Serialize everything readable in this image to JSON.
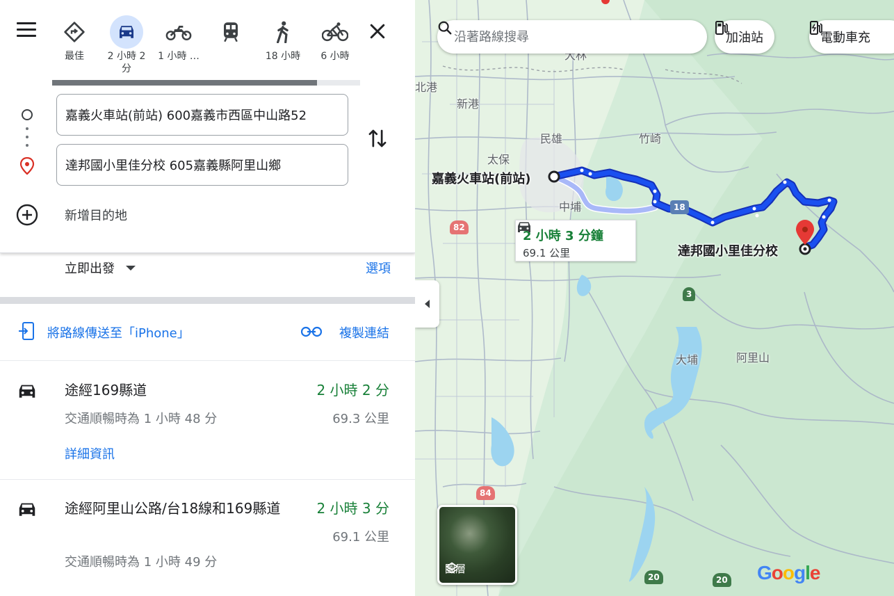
{
  "travel_modes": [
    {
      "name": "best",
      "label": "最佳",
      "active": false
    },
    {
      "name": "driving",
      "label": "2 小時 2 分",
      "active": true
    },
    {
      "name": "motorcycle",
      "label": "1 小時 …",
      "active": false
    },
    {
      "name": "transit",
      "label": "",
      "active": false
    },
    {
      "name": "walking",
      "label": "18 小時",
      "active": false
    },
    {
      "name": "cycling",
      "label": "6 小時",
      "active": false
    }
  ],
  "origin": {
    "value": "嘉義火車站(前站) 600嘉義市西區中山路52"
  },
  "destination": {
    "value": "達邦國小里佳分校 605嘉義縣阿里山鄉"
  },
  "add_destination_label": "新增目的地",
  "depart_label": "立即出發",
  "options_label": "選項",
  "send_to_phone_label": "將路線傳送至「iPhone」",
  "copy_link_label": "複製連結",
  "routes": [
    {
      "title": "途經169縣道",
      "duration": "2 小時 2 分",
      "traffic": "交通順暢時為 1 小時 48 分",
      "distance": "69.3 公里",
      "details_label": "詳細資訊"
    },
    {
      "title": "途經阿里山公路/台18線和169縣道",
      "duration": "2 小時 3 分",
      "traffic": "交通順暢時為 1 小時 49 分",
      "distance": "69.1 公里"
    }
  ],
  "map": {
    "search_placeholder": "沿著路線搜尋",
    "chips": [
      "加油站",
      "電動車充"
    ],
    "origin_label": "嘉義火車站(前站)",
    "destination_label": "達邦國小里佳分校",
    "callout": {
      "duration": "2 小時 3 分鐘",
      "distance": "69.1 公里"
    },
    "layers_label": "圖層",
    "place_names": [
      "北港",
      "新港",
      "民雄",
      "竹崎",
      "太保",
      "中埔",
      "大埔",
      "阿里山",
      "大林"
    ],
    "road_shields": [
      "82",
      "18",
      "3",
      "84",
      "20",
      "20"
    ],
    "logo": "Google",
    "colors": {
      "route_primary": "#1a50f0",
      "route_alt": "#a8b8f8",
      "water": "#9cd4f0",
      "land": "#d4ecd9"
    }
  }
}
